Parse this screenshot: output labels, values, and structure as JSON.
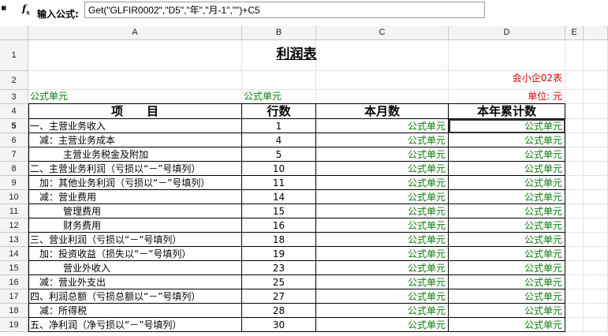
{
  "formula_bar": {
    "icon": "fx-icon",
    "label": "输入公式:",
    "value": "Get(\"GLFIR0002\",\"D5\",\"年\",\"月-1\",\"\")+C5"
  },
  "columns": [
    "A",
    "B",
    "C",
    "D",
    "E"
  ],
  "rows": [
    "1",
    "2",
    "3",
    "4",
    "5",
    "6",
    "7",
    "8",
    "9",
    "10",
    "11",
    "12",
    "13",
    "14",
    "15",
    "16",
    "17",
    "18",
    "19"
  ],
  "sheet": {
    "title": "利润表",
    "form_code": "会小企02表",
    "unit_label": "单位: 元",
    "a3": "公式单元",
    "b3": "公式单元",
    "headers": [
      "项　　目",
      "行数",
      "本月数",
      "本年累计数"
    ],
    "formula_text": "公式单元",
    "items": [
      {
        "name": "一、主营业务收入",
        "indent": 0,
        "line": "1"
      },
      {
        "name": "减：主营业务成本",
        "indent": 1,
        "line": "4"
      },
      {
        "name": "主营业务税金及附加",
        "indent": 2,
        "line": "5"
      },
      {
        "name": "二、主营业务利润（亏损以“－”号填列）",
        "indent": 0,
        "line": "10"
      },
      {
        "name": "加：其他业务利润（亏损以“－”号填列）",
        "indent": 1,
        "line": "11"
      },
      {
        "name": "减：营业费用",
        "indent": 1,
        "line": "14"
      },
      {
        "name": "管理费用",
        "indent": 2,
        "line": "15"
      },
      {
        "name": "财务费用",
        "indent": 2,
        "line": "16"
      },
      {
        "name": "三、营业利润（亏损以“－”号填列）",
        "indent": 0,
        "line": "18"
      },
      {
        "name": "加：投资收益（损失以“－”号填列）",
        "indent": 1,
        "line": "19"
      },
      {
        "name": "营业外收入",
        "indent": 2,
        "line": "23"
      },
      {
        "name": "减：营业外支出",
        "indent": 1,
        "line": "25"
      },
      {
        "name": "四、利润总额（亏损总额以“－”号填列）",
        "indent": 0,
        "line": "27"
      },
      {
        "name": "减：所得税",
        "indent": 1,
        "line": "28"
      },
      {
        "name": "五、净利润（净亏损以“－”号填列）",
        "indent": 0,
        "line": "30"
      }
    ]
  },
  "colors": {
    "green": "#0a7d0a",
    "red": "#e00000"
  }
}
